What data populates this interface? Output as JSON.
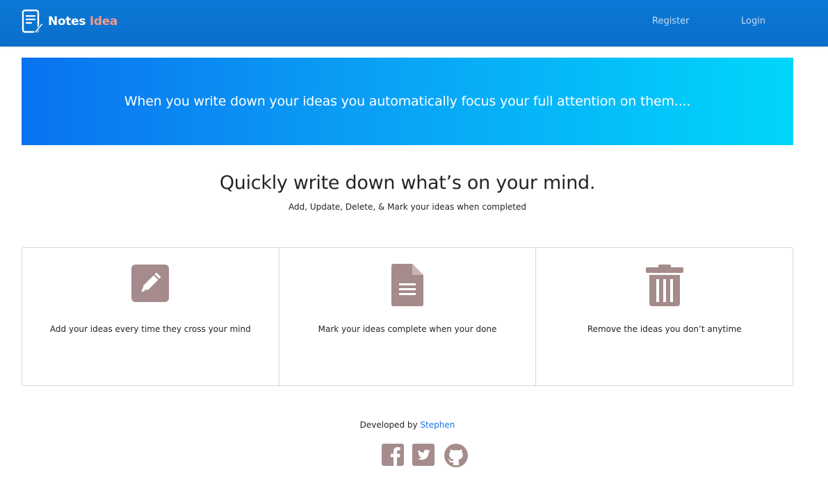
{
  "navbar": {
    "brand_main": "Notes",
    "brand_accent": "Idea",
    "links": [
      "Register",
      "Login"
    ],
    "icon": "notes-pen-icon"
  },
  "banner": {
    "text": "When you write down your ideas you automatically focus your full attention on them...."
  },
  "hero": {
    "title": "Quickly write down what’s on your mind.",
    "subtitle": "Add, Update, Delete, & Mark your ideas when completed"
  },
  "features": [
    {
      "icon": "edit-icon",
      "text": "Add your ideas every time they cross your mind"
    },
    {
      "icon": "document-icon",
      "text": "Mark your ideas complete when your done"
    },
    {
      "icon": "trash-icon",
      "text": "Remove the ideas you don’t anytime"
    }
  ],
  "footer": {
    "prefix": "Developed by ",
    "author": "Stephen",
    "social_icons": [
      "facebook-icon",
      "twitter-icon",
      "github-icon"
    ]
  },
  "colors": {
    "navbar": "#0a6fcb",
    "brand_accent": "#f29a8e",
    "banner_start": "#0a72f0",
    "banner_end": "#00d6fb",
    "icon": "#a58b8b",
    "link": "#1a73e8"
  }
}
